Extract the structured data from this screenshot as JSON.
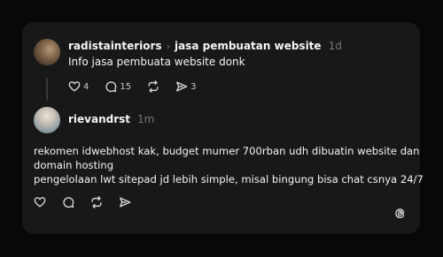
{
  "post": {
    "username": "radistainteriors",
    "topic": "jasa pembuatan website",
    "time": "1d",
    "text": "Info jasa pembuata website donk",
    "likes": "4",
    "replies": "15",
    "shares": "3"
  },
  "reply": {
    "username": "rievandrst",
    "time": "1m",
    "lines": [
      "rekomen idwebhost kak, budget mumer 700rban udh dibuatin website dan",
      "domain hosting",
      "pengelolaan lwt sitepad jd lebih simple, misal bingung bisa chat csnya 24/7"
    ]
  },
  "icons": [
    "heart-icon",
    "comment-icon",
    "repost-icon",
    "share-icon",
    "threads-logo-icon",
    "chevron-right-icon"
  ]
}
